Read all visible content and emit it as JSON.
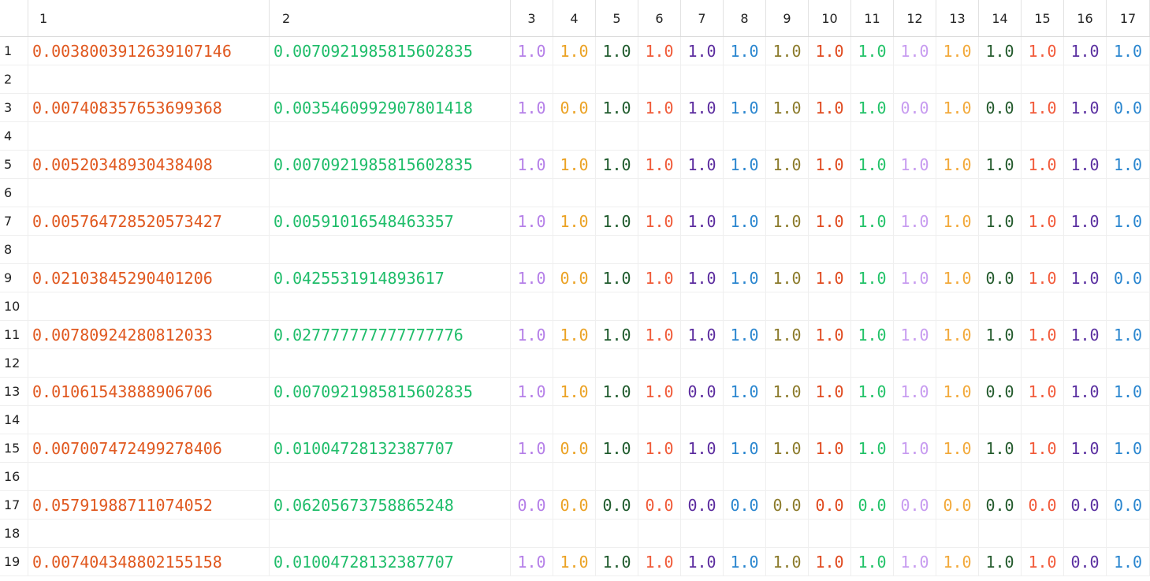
{
  "columns": [
    "1",
    "2",
    "3",
    "4",
    "5",
    "6",
    "7",
    "8",
    "9",
    "10",
    "11",
    "12",
    "13",
    "14",
    "15",
    "16",
    "17"
  ],
  "column_colors": [
    "#e0581f",
    "#1fbd6a",
    "#b57fe8",
    "#eba224",
    "#1e5a2c",
    "#f05a38",
    "#5b2b9e",
    "#2a86cf",
    "#8b7a2a",
    "#e04a1f",
    "#22c268",
    "#c79bf0",
    "#f2a93a",
    "#235a2c",
    "#f25a3a",
    "#5a2fa0",
    "#2a86cf"
  ],
  "rows": [
    {
      "n": "1",
      "cells": [
        "0.0038003912639107146",
        "0.0070921985815602835",
        "1.0",
        "1.0",
        "1.0",
        "1.0",
        "1.0",
        "1.0",
        "1.0",
        "1.0",
        "1.0",
        "1.0",
        "1.0",
        "1.0",
        "1.0",
        "1.0",
        "1.0"
      ]
    },
    {
      "n": "2",
      "cells": []
    },
    {
      "n": "3",
      "cells": [
        "0.007408357653699368",
        "0.0035460992907801418",
        "1.0",
        "0.0",
        "1.0",
        "1.0",
        "1.0",
        "1.0",
        "1.0",
        "1.0",
        "1.0",
        "0.0",
        "1.0",
        "0.0",
        "1.0",
        "1.0",
        "0.0"
      ]
    },
    {
      "n": "4",
      "cells": []
    },
    {
      "n": "5",
      "cells": [
        "0.0052034893043840​8",
        "0.0070921985815602835",
        "1.0",
        "1.0",
        "1.0",
        "1.0",
        "1.0",
        "1.0",
        "1.0",
        "1.0",
        "1.0",
        "1.0",
        "1.0",
        "1.0",
        "1.0",
        "1.0",
        "1.0"
      ]
    },
    {
      "n": "6",
      "cells": []
    },
    {
      "n": "7",
      "cells": [
        "0.005764728520573427",
        "0.00591016548463357",
        "1.0",
        "1.0",
        "1.0",
        "1.0",
        "1.0",
        "1.0",
        "1.0",
        "1.0",
        "1.0",
        "1.0",
        "1.0",
        "1.0",
        "1.0",
        "1.0",
        "1.0"
      ]
    },
    {
      "n": "8",
      "cells": []
    },
    {
      "n": "9",
      "cells": [
        "0.0210384529040120​6",
        "0.0425531914893617",
        "1.0",
        "0.0",
        "1.0",
        "1.0",
        "1.0",
        "1.0",
        "1.0",
        "1.0",
        "1.0",
        "1.0",
        "1.0",
        "0.0",
        "1.0",
        "1.0",
        "0.0"
      ]
    },
    {
      "n": "10",
      "cells": []
    },
    {
      "n": "11",
      "cells": [
        "0.0078092428081203​3",
        "0.027777777777777776",
        "1.0",
        "1.0",
        "1.0",
        "1.0",
        "1.0",
        "1.0",
        "1.0",
        "1.0",
        "1.0",
        "1.0",
        "1.0",
        "1.0",
        "1.0",
        "1.0",
        "1.0"
      ]
    },
    {
      "n": "12",
      "cells": []
    },
    {
      "n": "13",
      "cells": [
        "0.01061543888906706",
        "0.0070921985815602835",
        "1.0",
        "1.0",
        "1.0",
        "1.0",
        "0.0",
        "1.0",
        "1.0",
        "1.0",
        "1.0",
        "1.0",
        "1.0",
        "0.0",
        "1.0",
        "1.0",
        "1.0"
      ]
    },
    {
      "n": "14",
      "cells": []
    },
    {
      "n": "15",
      "cells": [
        "0.007007472499278406",
        "0.01004728132387707",
        "1.0",
        "0.0",
        "1.0",
        "1.0",
        "1.0",
        "1.0",
        "1.0",
        "1.0",
        "1.0",
        "1.0",
        "1.0",
        "1.0",
        "1.0",
        "1.0",
        "1.0"
      ]
    },
    {
      "n": "16",
      "cells": []
    },
    {
      "n": "17",
      "cells": [
        "0.05791988711074052",
        "0.06205673758865248",
        "0.0",
        "0.0",
        "0.0",
        "0.0",
        "0.0",
        "0.0",
        "0.0",
        "0.0",
        "0.0",
        "0.0",
        "0.0",
        "0.0",
        "0.0",
        "0.0",
        "0.0"
      ]
    },
    {
      "n": "18",
      "cells": []
    },
    {
      "n": "19",
      "cells": [
        "0.007404348802155158",
        "0.01004728132387707",
        "1.0",
        "1.0",
        "1.0",
        "1.0",
        "1.0",
        "1.0",
        "1.0",
        "1.0",
        "1.0",
        "1.0",
        "1.0",
        "1.0",
        "1.0",
        "0.0",
        "1.0"
      ]
    }
  ]
}
